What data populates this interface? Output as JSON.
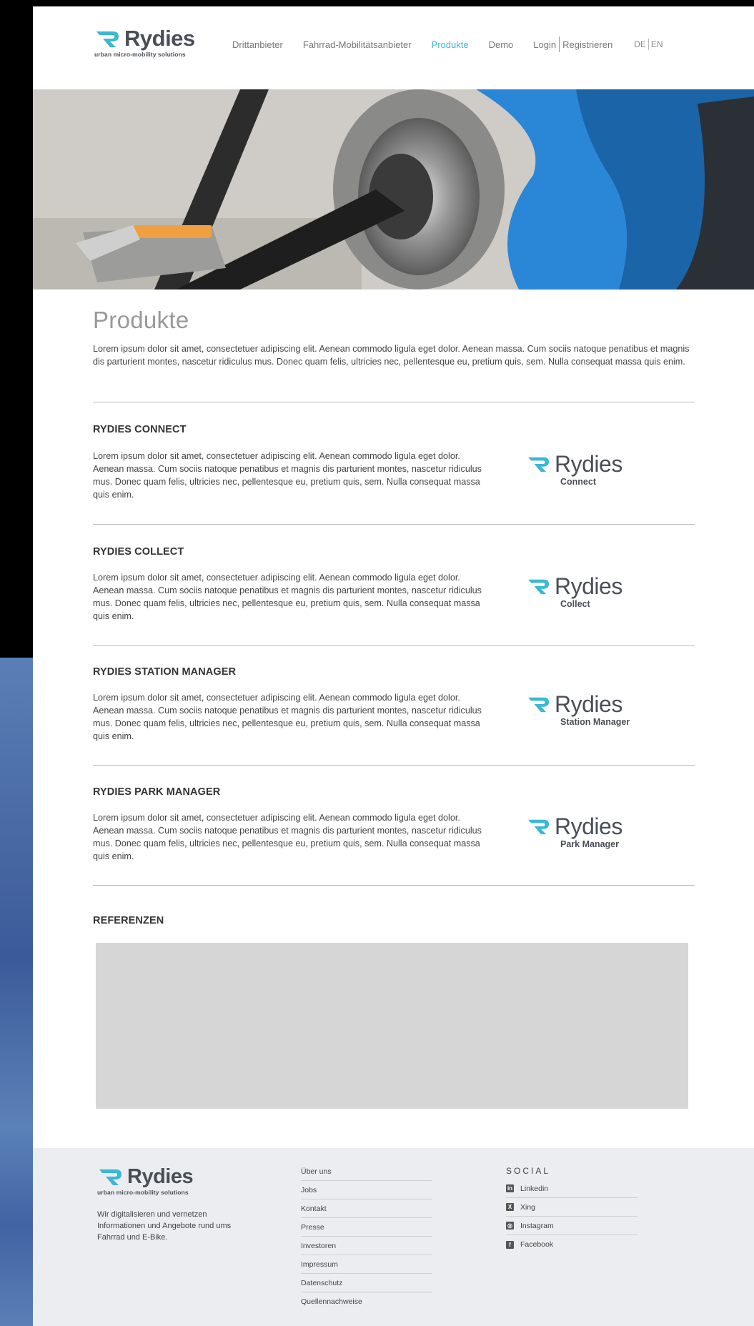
{
  "brand": {
    "name": "Rydies",
    "tagline": "urban micro-mobility solutions",
    "accent": "#3bb8d2",
    "text_color": "#4a4f57"
  },
  "nav": {
    "items": [
      "Drittanbieter",
      "Fahrrad-Mobilitätsanbieter",
      "Produkte",
      "Demo"
    ],
    "active": "Produkte",
    "login": "Login",
    "register": "Registrieren",
    "lang_de": "DE",
    "lang_en": "EN"
  },
  "hero": {
    "icon": "bike-pedal-photo"
  },
  "page": {
    "title": "Produkte",
    "intro": "Lorem ipsum dolor sit amet, consectetuer adipiscing elit. Aenean commodo ligula eget dolor. Aenean massa. Cum sociis natoque penatibus et magnis dis parturient montes, nascetur ridiculus mus. Donec quam felis, ultricies nec, pellentesque eu, pretium quis, sem. Nulla consequat massa quis enim."
  },
  "products": [
    {
      "title": "RYDIES CONNECT",
      "text": "Lorem ipsum dolor sit amet, consectetuer adipiscing elit. Aenean commodo ligula eget dolor. Aenean massa. Cum sociis natoque penatibus et magnis dis parturient montes, nascetur ridiculus mus. Donec quam felis, ultricies nec, pellentesque eu, pretium quis, sem. Nulla consequat massa quis enim.",
      "logo_name": "Rydies",
      "logo_sub": "Connect"
    },
    {
      "title": "RYDIES COLLECT",
      "text": "Lorem ipsum dolor sit amet, consectetuer adipiscing elit. Aenean commodo ligula eget dolor. Aenean massa. Cum sociis natoque penatibus et magnis dis parturient montes, nascetur ridiculus mus. Donec quam felis, ultricies nec, pellentesque eu, pretium quis, sem. Nulla consequat massa quis enim.",
      "logo_name": "Rydies",
      "logo_sub": "Collect"
    },
    {
      "title": "RYDIES STATION MANAGER",
      "text": "Lorem ipsum dolor sit amet, consectetuer adipiscing elit. Aenean commodo ligula eget dolor. Aenean massa. Cum sociis natoque penatibus et magnis dis parturient montes, nascetur ridiculus mus. Donec quam felis, ultricies nec, pellentesque eu, pretium quis, sem. Nulla consequat massa quis enim.",
      "logo_name": "Rydies",
      "logo_sub": "Station Manager"
    },
    {
      "title": "RYDIES PARK MANAGER",
      "text": "Lorem ipsum dolor sit amet, consectetuer adipiscing elit. Aenean commodo ligula eget dolor. Aenean massa. Cum sociis natoque penatibus et magnis dis parturient montes, nascetur ridiculus mus. Donec quam felis, ultricies nec, pellentesque eu, pretium quis, sem. Nulla consequat massa quis enim.",
      "logo_name": "Rydies",
      "logo_sub": "Park Manager"
    }
  ],
  "references": {
    "title": "REFERENZEN"
  },
  "footer": {
    "description": "Wir digitalisieren und vernetzen Informationen und Angebote rund ums Fahrrad und E-Bike.",
    "links": [
      "Über uns",
      "Jobs",
      "Kontakt",
      "Presse",
      "Investoren",
      "Impressum",
      "Datenschutz",
      "Quellennachweise"
    ],
    "social_title": "SOCIAL",
    "social": [
      {
        "label": "Linkedin",
        "icon": "linkedin-icon",
        "glyph": "in"
      },
      {
        "label": "Xing",
        "icon": "xing-icon",
        "glyph": "X"
      },
      {
        "label": "Instagram",
        "icon": "instagram-icon",
        "glyph": "◎"
      },
      {
        "label": "Facebook",
        "icon": "facebook-icon",
        "glyph": "f"
      }
    ]
  }
}
